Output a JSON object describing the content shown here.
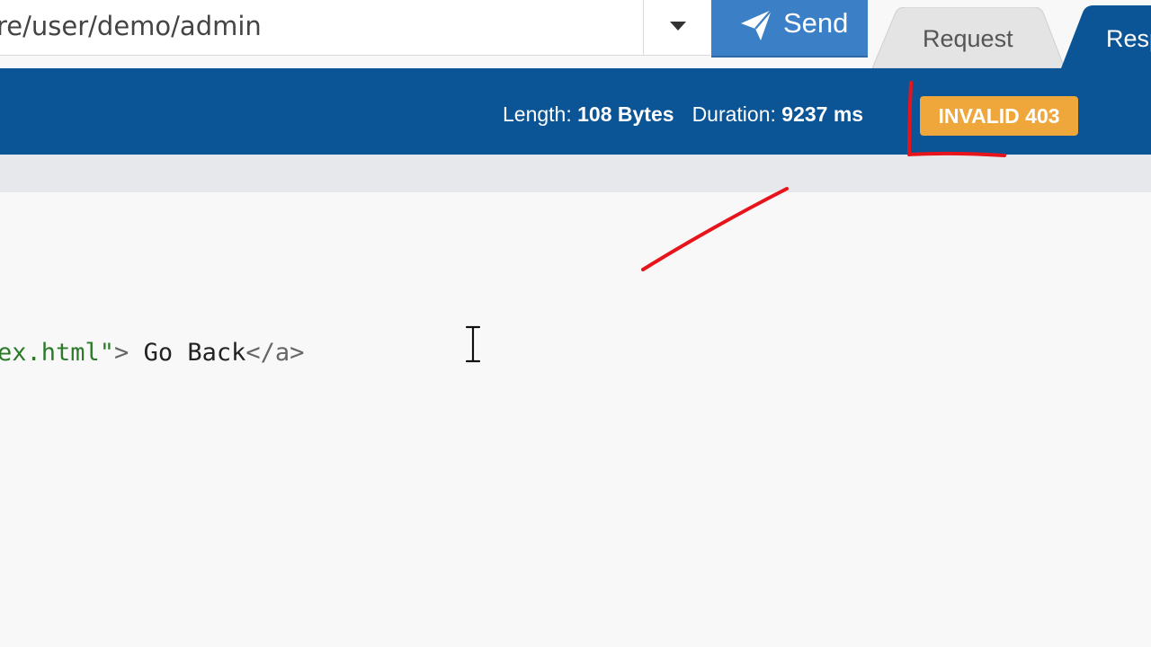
{
  "request_bar": {
    "url": "re/user/demo/admin",
    "method_dropdown_icon": "caret-down-icon",
    "send_label": "Send",
    "send_icon": "paper-plane-icon"
  },
  "tabs": [
    {
      "label": "Request",
      "active": false
    },
    {
      "label": "Resp",
      "active": true
    }
  ],
  "status_bar": {
    "length_label": "Length:",
    "length_value": "108 Bytes",
    "duration_label": "Duration:",
    "duration_value": "9237 ms",
    "status_text": "INVALID 403"
  },
  "response": {
    "code_string": "ex.html\"",
    "code_tag_open": ">",
    "code_text": " Go Back",
    "code_tag_close": "</a>"
  },
  "colors": {
    "status_bar": "#0b5597",
    "send_button": "#3b80c6",
    "status_badge": "#efa73b",
    "annotation": "#e8141b"
  }
}
